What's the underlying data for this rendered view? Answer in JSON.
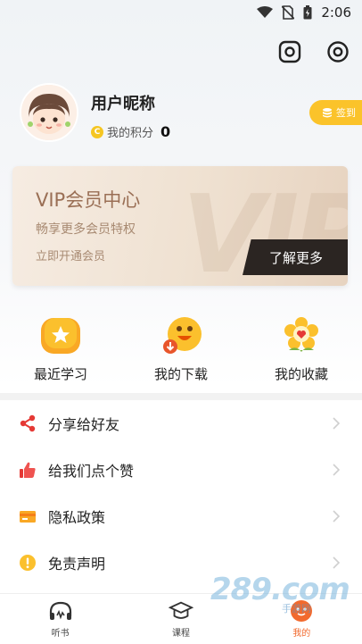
{
  "status_bar": {
    "time": "2:06"
  },
  "profile": {
    "nickname": "用户昵称",
    "points_label": "我的积分",
    "points_value": "0",
    "coin_symbol": "C",
    "signin_label": "签到"
  },
  "vip": {
    "title": "VIP会员中心",
    "subtitle": "畅享更多会员特权",
    "subtitle2": "立即开通会员",
    "button_label": "了解更多",
    "bg_letters": "VIP"
  },
  "quick_actions": [
    {
      "label": "最近学习",
      "icon": "star-badge-icon"
    },
    {
      "label": "我的下载",
      "icon": "download-face-icon"
    },
    {
      "label": "我的收藏",
      "icon": "favorite-flower-icon"
    }
  ],
  "menu": [
    {
      "label": "分享给好友",
      "icon": "share-icon"
    },
    {
      "label": "给我们点个赞",
      "icon": "thumbs-up-icon"
    },
    {
      "label": "隐私政策",
      "icon": "privacy-card-icon"
    },
    {
      "label": "免责声明",
      "icon": "exclamation-icon"
    }
  ],
  "tabbar": [
    {
      "label": "听书",
      "icon": "headphones-icon",
      "active": false
    },
    {
      "label": "课程",
      "icon": "graduation-cap-icon",
      "active": false
    },
    {
      "label": "我的",
      "icon": "profile-face-icon",
      "active": true
    }
  ],
  "watermark": {
    "main": "289.com",
    "sub": "手游网"
  },
  "colors": {
    "accent": "#f26a2e",
    "signin": "#fbc32a",
    "vip_text": "#9a6f55",
    "vip_button": "#2b2522"
  }
}
